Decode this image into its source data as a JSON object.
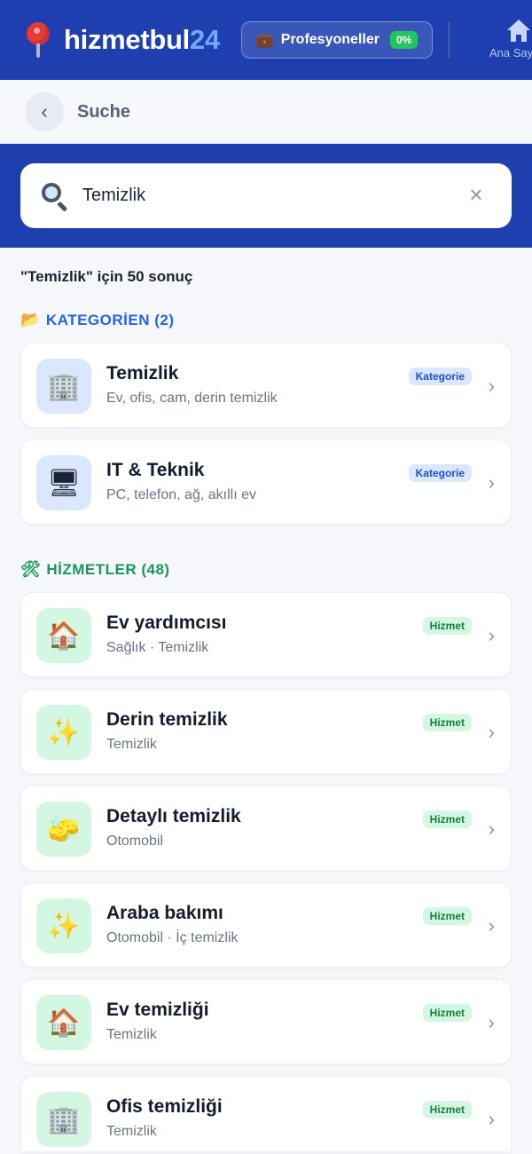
{
  "app": {
    "logo_main": "hizmetbul",
    "logo_accent": "24",
    "pro_button_label": "Profesyoneller",
    "pro_badge": "0%",
    "home_label": "Ana Sayfa"
  },
  "page": {
    "title": "Suche"
  },
  "search": {
    "value": "Temizlik",
    "placeholder": ""
  },
  "results": {
    "count_text": "\"Temizlik\" için 50 sonuç"
  },
  "categories": {
    "heading": "KATEGORİEN (2)",
    "items": [
      {
        "title": "Temizlik",
        "subtitle": "Ev, ofis, cam, derin temizlik",
        "badge": "Kategorie",
        "icon": "🏢"
      },
      {
        "title": "IT & Teknik",
        "subtitle": "PC, telefon, ağ, akıllı ev",
        "badge": "Kategorie",
        "icon": "🖥"
      }
    ]
  },
  "services": {
    "heading": "HİZMETLER (48)",
    "items": [
      {
        "title": "Ev yardımcısı",
        "subtitle": "Sağlık · Temizlik",
        "badge": "Hizmet",
        "icon": "🏠"
      },
      {
        "title": "Derin temizlik",
        "subtitle": "Temizlik",
        "badge": "Hizmet",
        "icon": "✨"
      },
      {
        "title": "Detaylı temizlik",
        "subtitle": "Otomobil",
        "badge": "Hizmet",
        "icon": "🧽"
      },
      {
        "title": "Araba bakımı",
        "subtitle": "Otomobil · İç temizlik",
        "badge": "Hizmet",
        "icon": "✨"
      },
      {
        "title": "Ev temizliği",
        "subtitle": "Temizlik",
        "badge": "Hizmet",
        "icon": "🏠"
      },
      {
        "title": "Ofis temizliği",
        "subtitle": "Temizlik",
        "badge": "Hizmet",
        "icon": "🏢"
      }
    ]
  },
  "colors": {
    "brand_blue": "#1f3fb0",
    "category_accent": "#2563eb",
    "service_accent": "#169a5b"
  }
}
